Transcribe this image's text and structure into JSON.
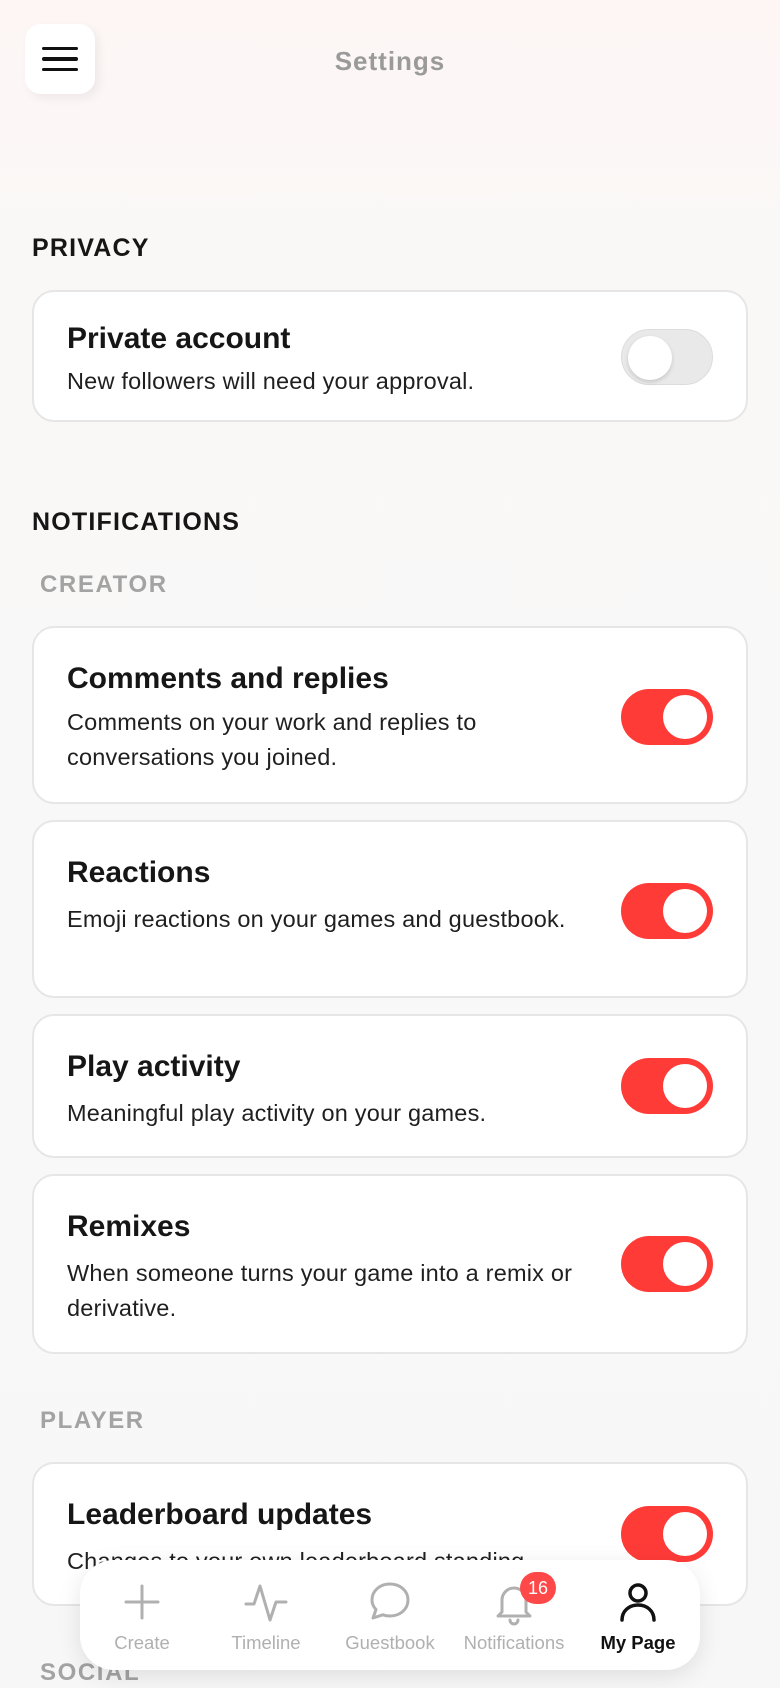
{
  "header": {
    "title": "Settings"
  },
  "privacy": {
    "heading": "PRIVACY",
    "items": [
      {
        "title": "Private account",
        "desc": "New followers will need your approval.",
        "enabled": false
      }
    ]
  },
  "notifications": {
    "heading": "NOTIFICATIONS",
    "creator": {
      "heading": "CREATOR",
      "items": [
        {
          "title": "Comments and replies",
          "desc": "Comments on your work and replies to conversations you joined.",
          "enabled": true
        },
        {
          "title": "Reactions",
          "desc": "Emoji reactions on your games and guestbook.",
          "enabled": true
        },
        {
          "title": "Play activity",
          "desc": "Meaningful play activity on your games.",
          "enabled": true
        },
        {
          "title": "Remixes",
          "desc": "When someone turns your game into a remix or derivative.",
          "enabled": true
        }
      ]
    },
    "player": {
      "heading": "PLAYER",
      "items": [
        {
          "title": "Leaderboard updates",
          "desc": "Changes to your own leaderboard standing",
          "enabled": true
        }
      ]
    },
    "social": {
      "heading": "SOCIAL"
    }
  },
  "bottom_nav": {
    "items": [
      {
        "label": "Create",
        "icon": "plus-icon"
      },
      {
        "label": "Timeline",
        "icon": "activity-icon"
      },
      {
        "label": "Guestbook",
        "icon": "chat-bubble-icon"
      },
      {
        "label": "Notifications",
        "icon": "bell-icon",
        "badge": "16"
      },
      {
        "label": "My Page",
        "icon": "user-icon",
        "active": true
      }
    ]
  },
  "colors": {
    "accent": "#ff3b38",
    "toggle_off": "#e9e9e9",
    "muted": "#a3a3a3"
  }
}
